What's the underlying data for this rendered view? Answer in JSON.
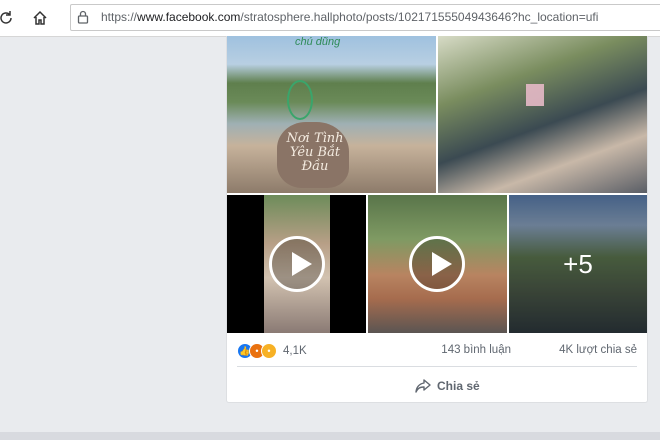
{
  "browser": {
    "url_prefix": "https://",
    "url_domain": "www.facebook.com",
    "url_path": "/stratosphere.hallphoto/posts/10217155504943646?hc_location=ufi"
  },
  "post": {
    "media": [
      {
        "type": "photo",
        "caption_text": "Nơi Tình Yêu Bắt Đầu",
        "handwritten": "chú dũng"
      },
      {
        "type": "photo"
      },
      {
        "type": "video"
      },
      {
        "type": "video"
      },
      {
        "type": "photo",
        "overlay": "+5"
      }
    ],
    "reaction_count": "4,1K",
    "comments": "143 bình luận",
    "shares": "4K lượt chia sẻ",
    "share_button": "Chia sẻ"
  }
}
